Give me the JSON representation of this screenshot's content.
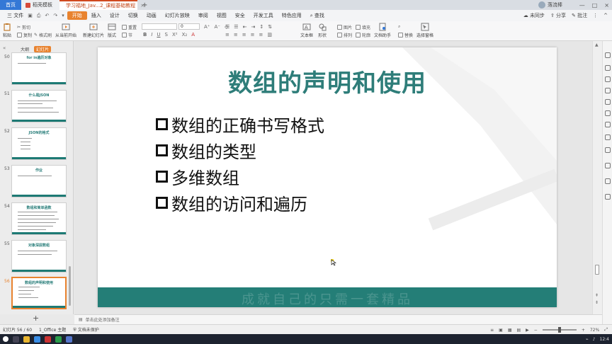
{
  "tabs": {
    "home": "首页",
    "doc1": "稻壳模板",
    "doc2": "学习福地_Jav...2_课程基础教程"
  },
  "user": {
    "name": "落流棒"
  },
  "menubar": {
    "file": "三 文件",
    "items": [
      "开始",
      "插入",
      "设计",
      "切换",
      "动画",
      "幻灯片放映",
      "审阅",
      "视图",
      "安全",
      "开发工具",
      "特色应用"
    ],
    "active_index": 0,
    "search": "查找",
    "right": [
      "未同步",
      "分享",
      "批注"
    ]
  },
  "ribbon": {
    "paste": "粘贴",
    "cut": "剪切",
    "copy": "复制",
    "format_painter": "格式刷",
    "from_current": "从当前开始",
    "new_slide": "新建幻灯片",
    "layout": "版式",
    "reset": "重置",
    "section": "节",
    "font_size": "0",
    "textbox": "文本框",
    "shape": "形状",
    "arrange": "排列",
    "outline": "轮廓",
    "picture": "图片",
    "fill": "填充",
    "replace": "替换",
    "doc_helper": "文档助手",
    "select_pane": "选择窗格"
  },
  "left_panel": {
    "tab_outline": "大纲",
    "tab_slides": "幻灯片",
    "thumbnails": [
      {
        "num": "50",
        "title": "for in遍历对象"
      },
      {
        "num": "51",
        "title": "什么是JSON"
      },
      {
        "num": "52",
        "title": "JSON的格式"
      },
      {
        "num": "53",
        "title": "作业"
      },
      {
        "num": "54",
        "title": "数组和简单函数"
      },
      {
        "num": "55",
        "title": "对象深层数组"
      },
      {
        "num": "56",
        "title": "数组的声明和使用"
      }
    ],
    "active_index": 6
  },
  "slide": {
    "title": "数组的声明和使用",
    "bullets": [
      "数组的正确书写格式",
      "数组的类型",
      "多维数组",
      "数组的访问和遍历"
    ],
    "footer": "成就自己的只需一套精品"
  },
  "notes": {
    "placeholder": "单击此处添加备注"
  },
  "statusbar": {
    "slide_info": "幻灯片 56 / 60",
    "theme": "1_Office 主题",
    "doc_recovery": "文档未保护",
    "zoom": "72%"
  },
  "taskbar": {
    "time": "12:4"
  },
  "colors": {
    "accent": "#e8832f",
    "teal": "#2e7d79",
    "footer": "#247e77"
  }
}
